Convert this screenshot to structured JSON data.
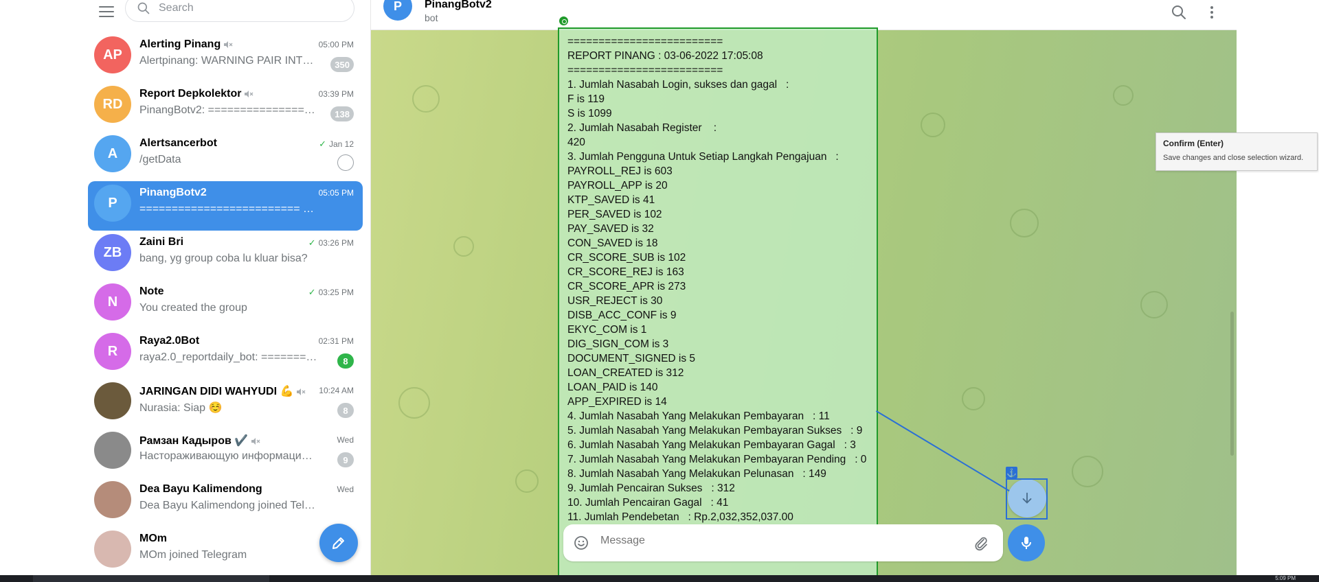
{
  "sidebar": {
    "search_placeholder": "Search",
    "chats": [
      {
        "initials": "AP",
        "color": "#f2645f",
        "name": "Alerting Pinang",
        "muted": true,
        "time": "05:00 PM",
        "message": "Alertpinang: WARNING PAIR INTER...",
        "badge": "350",
        "badge_style": "muted"
      },
      {
        "initials": "RD",
        "color": "#f5b04a",
        "name": "Report Depkolektor",
        "muted": true,
        "time": "03:39 PM",
        "message": "PinangBotv2: ==================...",
        "badge": "138",
        "badge_style": "muted"
      },
      {
        "initials": "A",
        "color": "#55a6f0",
        "name": "Alertsancerbot",
        "time": "Jan 12",
        "read": true,
        "message": "/getData",
        "pinned": true
      },
      {
        "initials": "P",
        "color": "#55a6f0",
        "name": "PinangBotv2",
        "time": "05:05 PM",
        "message": "========================= REPORT ...",
        "active": true
      },
      {
        "initials": "ZB",
        "color": "#6c7cf5",
        "name": "Zaini Bri",
        "time": "03:26 PM",
        "read": true,
        "message": "bang, yg group coba lu kluar bisa?"
      },
      {
        "initials": "N",
        "color": "#d56be8",
        "name": "Note",
        "time": "03:25 PM",
        "read": true,
        "message": "You created the group"
      },
      {
        "initials": "R",
        "color": "#d56be8",
        "name": "Raya2.0Bot",
        "time": "02:31 PM",
        "message": "raya2.0_reportdaily_bot: ==========...",
        "badge": "8",
        "badge_style": "green"
      },
      {
        "initials": "",
        "color": "#6b5a3c",
        "name": "JARINGAN DIDI WAHYUDI 💪",
        "muted": true,
        "time": "10:24 AM",
        "message": "Nurasia: Siap ☺️",
        "badge": "8",
        "badge_style": "muted"
      },
      {
        "initials": "",
        "color": "#8a8a8a",
        "name": "Рамзан Кадыров ✔️",
        "muted": true,
        "time": "Wed",
        "message": "Настораживающую информацию в...",
        "badge": "9",
        "badge_style": "muted"
      },
      {
        "initials": "",
        "color": "#b58c7a",
        "name": "Dea Bayu Kalimendong",
        "time": "Wed",
        "message": "Dea Bayu Kalimendong joined Telegram"
      },
      {
        "initials": "",
        "color": "#d8b8b0",
        "name": "MOm",
        "time": "",
        "message": "MOm joined Telegram"
      }
    ]
  },
  "header": {
    "avatar_initial": "P",
    "title": "PinangBotv2",
    "subtitle": "bot"
  },
  "message": {
    "lines": [
      "=========================",
      "REPORT PINANG : 03-06-2022 17:05:08",
      "=========================",
      "1. Jumlah Nasabah Login, sukses dan gagal   :",
      "F is 119",
      "S is 1099",
      "2. Jumlah Nasabah Register    :",
      "420",
      "3. Jumlah Pengguna Untuk Setiap Langkah Pengajuan   :",
      "PAYROLL_REJ is 603",
      "PAYROLL_APP is 20",
      "KTP_SAVED is 41",
      "PER_SAVED is 102",
      "PAY_SAVED is 32",
      "CON_SAVED is 18",
      "CR_SCORE_SUB is 102",
      "CR_SCORE_REJ is 163",
      "CR_SCORE_APR is 273",
      "USR_REJECT is 30",
      "DISB_ACC_CONF is 9",
      "EKYC_COM is 1",
      "DIG_SIGN_COM is 3",
      "DOCUMENT_SIGNED is 5",
      "LOAN_CREATED is 312",
      "LOAN_PAID is 140",
      "APP_EXPIRED is 14",
      "4. Jumlah Nasabah Yang Melakukan Pembayaran   : 11",
      "5. Jumlah Nasabah Yang Melakukan Pembayaran Sukses   : 9",
      "6. Jumlah Nasabah Yang Melakukan Pembayaran Gagal   : 3",
      "7. Jumlah Nasabah Yang Melakukan Pembayaran Pending   : 0",
      "8. Jumlah Nasabah Yang Melakukan Pelunasan   : 149",
      "9. Jumlah Pencairan Sukses   : 312",
      "10. Jumlah Pencairan Gagal   : 41",
      "11. Jumlah Pendebetan   : Rp.2,032,352,037.00"
    ]
  },
  "composer": {
    "placeholder": "Message"
  },
  "tooltip": {
    "title": "Confirm (Enter)",
    "description": "Save changes and close selection wizard."
  },
  "icons": {
    "menu": "hamburger-icon",
    "search": "search-icon",
    "more": "more-vertical-icon",
    "emoji": "smile-icon",
    "attach": "paperclip-icon",
    "mic": "microphone-icon",
    "scroll_down": "arrow-down-icon",
    "compose": "pencil-icon",
    "anchor": "anchor-icon"
  },
  "colors": {
    "accent": "#3f8fe8",
    "selection_green": "#1f9a2a",
    "selection_blue": "#2a6fd6"
  },
  "taskbar": {
    "clock": "5:09 PM"
  }
}
